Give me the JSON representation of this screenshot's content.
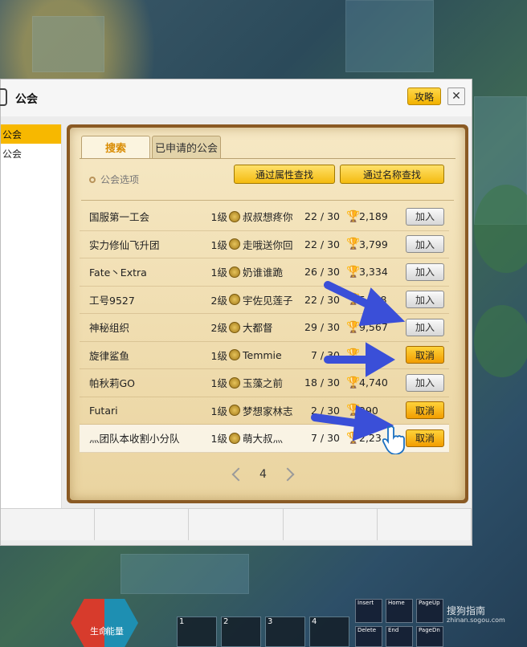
{
  "window": {
    "title": "公会",
    "guide_button": "攻略",
    "close_button": "✕",
    "sidebar": [
      {
        "label": "公会",
        "active": true
      },
      {
        "label": "公会",
        "active": false
      }
    ]
  },
  "panel": {
    "tabs": [
      {
        "label": "搜索",
        "active": true
      },
      {
        "label": "已申请的公会",
        "active": false
      }
    ],
    "options_label": "公会选项",
    "search_by_attribute": "通过属性查找",
    "search_by_name": "通过名称查找",
    "columns_note": "",
    "rows": [
      {
        "name": "国服第一工会",
        "level": "1级",
        "leader": "叔叔想疼你",
        "members": "22 / 30",
        "score": "2,189",
        "action": "加入",
        "action_type": "join"
      },
      {
        "name": "实力修仙飞升团",
        "level": "1级",
        "leader": "走哦送你回",
        "members": "22 / 30",
        "score": "3,799",
        "action": "加入",
        "action_type": "join"
      },
      {
        "name": "Fate丶Extra",
        "level": "1级",
        "leader": "奶谁谁跪",
        "members": "26 / 30",
        "score": "3,334",
        "action": "加入",
        "action_type": "join"
      },
      {
        "name": "工号9527",
        "level": "2级",
        "leader": "宇佐见莲子",
        "members": "22 / 30",
        "score": "5,?78",
        "action": "加入",
        "action_type": "join"
      },
      {
        "name": "神秘组织",
        "level": "2级",
        "leader": "大都督",
        "members": "29 / 30",
        "score": "9,567",
        "action": "加入",
        "action_type": "join"
      },
      {
        "name": "旋律鲨鱼",
        "level": "1级",
        "leader": "Temmie",
        "members": "7 / 30",
        "score": "",
        "action": "取消",
        "action_type": "cancel"
      },
      {
        "name": "帕秋莉GO",
        "level": "1级",
        "leader": "玉藻之前",
        "members": "18 / 30",
        "score": "4,740",
        "action": "加入",
        "action_type": "join"
      },
      {
        "name": "Futari",
        "level": "1级",
        "leader": "梦想家林志",
        "members": "2 / 30",
        "score": "290",
        "action": "取消",
        "action_type": "cancel"
      },
      {
        "name": "灬团队本收割小分队",
        "level": "1级",
        "leader": "萌大叔灬",
        "members": "7 / 30",
        "score": "2,23",
        "action": "取消",
        "action_type": "cancel",
        "highlight": true
      }
    ],
    "page_number": "4"
  },
  "hotbar": {
    "hp_label": "生命",
    "mp_label": "能量",
    "slots": [
      "1",
      "2",
      "3",
      "4"
    ],
    "keys": [
      "Insert",
      "Home",
      "PageUp",
      "Delete",
      "End",
      "PageDn"
    ]
  },
  "watermark": {
    "title": "搜狗指南",
    "url": "zhinan.sogou.com"
  },
  "colors": {
    "accent_yellow": "#f4bb10",
    "cancel_orange": "#f29d00",
    "arrow_blue": "#3a4fd8",
    "parchment": "#f1e0b4"
  }
}
